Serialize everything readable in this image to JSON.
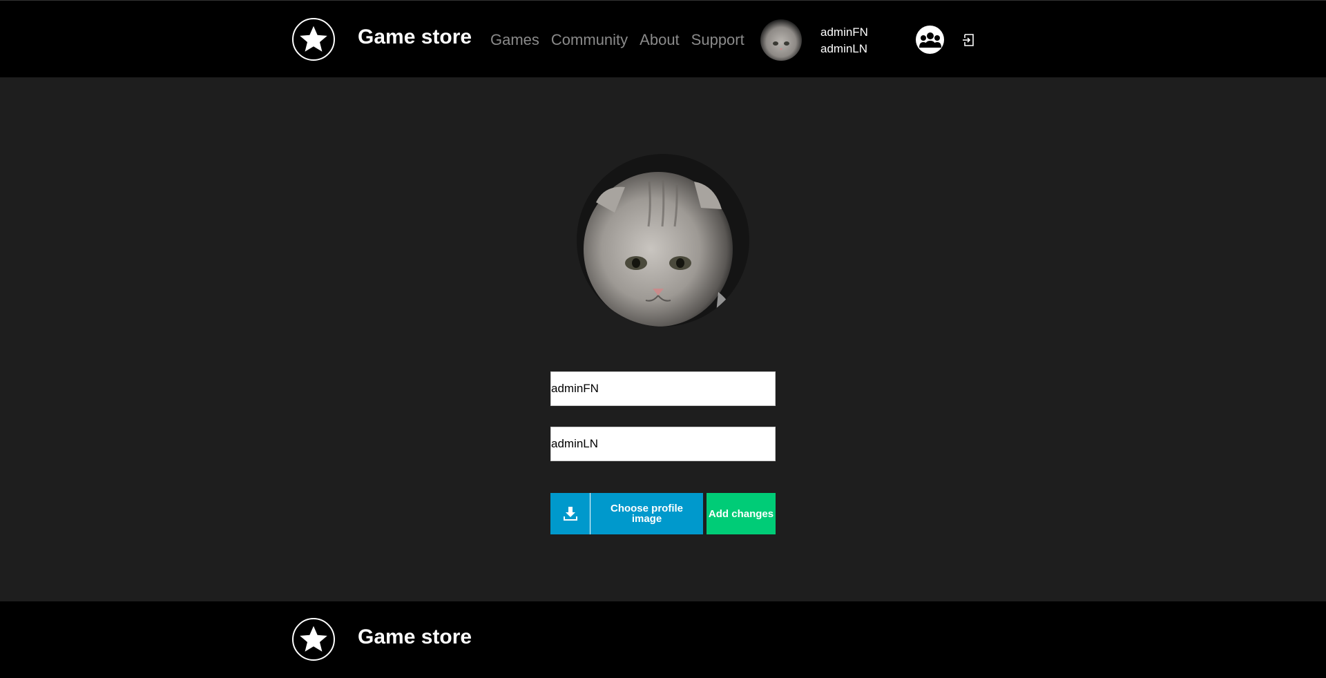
{
  "header": {
    "brand": "Game store",
    "nav": [
      "Games",
      "Community",
      "About",
      "Support"
    ],
    "user": {
      "first_name": "adminFN",
      "last_name": "adminLN"
    },
    "icons": [
      "star-logo-icon",
      "community-icon",
      "logout-icon"
    ]
  },
  "profile": {
    "first_name_value": "adminFN",
    "last_name_value": "adminLN",
    "choose_image_label": "Choose profile image",
    "add_changes_label": "Add changes"
  },
  "footer": {
    "brand": "Game store"
  },
  "colors": {
    "header_bg": "#000000",
    "page_bg": "#1e1e1e",
    "choose_button": "#0099cc",
    "add_button": "#00cc77",
    "nav_text": "#8a8a8a"
  }
}
